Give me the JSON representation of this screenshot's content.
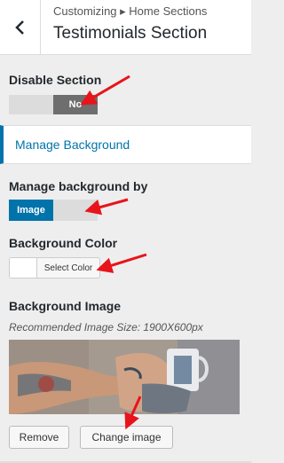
{
  "header": {
    "breadcrumb": "Customizing ▸ Home Sections",
    "title": "Testimonials Section"
  },
  "disable_section": {
    "label": "Disable Section",
    "toggle_value": "No"
  },
  "manage_background": {
    "label": "Manage Background"
  },
  "background_by": {
    "label": "Manage background by",
    "selected": "Image"
  },
  "background_color": {
    "label": "Background Color",
    "button_label": "Select Color"
  },
  "background_image": {
    "label": "Background Image",
    "recommended": "Recommended Image Size: 1900X600px",
    "remove_label": "Remove",
    "change_label": "Change image"
  },
  "colors": {
    "accent": "#0073aa",
    "annotation_arrow": "#e8141b"
  }
}
